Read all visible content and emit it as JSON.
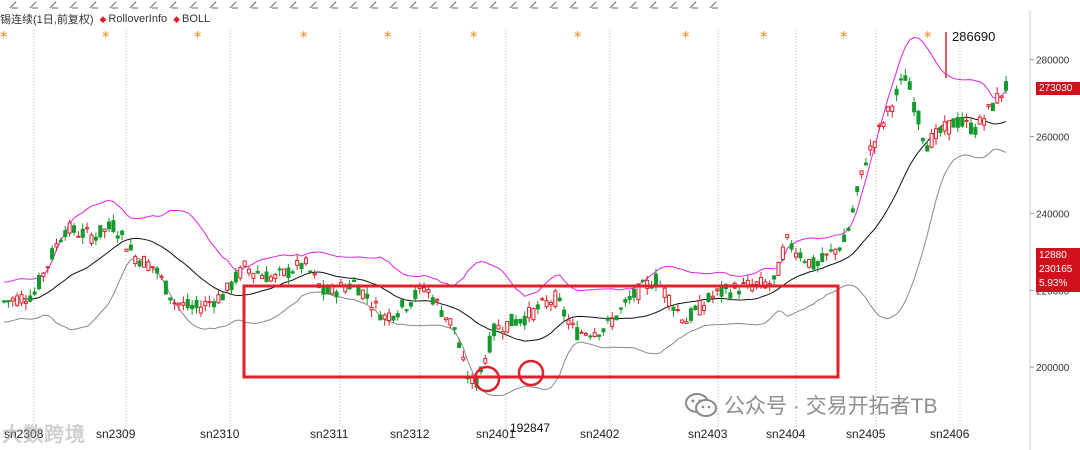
{
  "legend": {
    "title": "锡连续(1日,前复权)",
    "items": [
      {
        "label": "RolloverInfo",
        "color": "#e0202a"
      },
      {
        "label": "BOLL",
        "color": "#e0202a"
      }
    ]
  },
  "watermarks": {
    "left": "大数跨境",
    "right": "公众号 · 交易开拓者TB"
  },
  "price_badges": {
    "last_price": "273030",
    "info_line1": "12880",
    "info_line2": "230165",
    "info_line3": "5.93%"
  },
  "colors": {
    "up": "#e0202a",
    "down": "#139a2c",
    "boll_upper": "#e024e0",
    "boll_mid": "#111111",
    "boll_lower": "#888888",
    "box": "#e0202a",
    "marker": "#f08a1e"
  },
  "chart_data": {
    "type": "candlestick",
    "title": "",
    "xlabel": "",
    "ylabel": "",
    "ylim": [
      192000,
      290000
    ],
    "yticks": [
      200000,
      220000,
      240000,
      260000,
      280000
    ],
    "ytick_labels": [
      "200000",
      "220000",
      "240000",
      "260000",
      "280000"
    ],
    "x_tick_labels": [
      "sn2308",
      "sn2309",
      "sn2310",
      "sn2311",
      "sn2312",
      "sn2401",
      "sn2402",
      "sn2403",
      "sn2404",
      "sn2405",
      "sn2406"
    ],
    "annotations": [
      {
        "text": "286690",
        "type": "high",
        "value": 286690
      },
      {
        "text": "192847",
        "type": "low",
        "value": 192847
      }
    ],
    "rollover_markers": 11,
    "price_path": [
      {
        "t": 0,
        "v": 217000
      },
      {
        "t": 0.03,
        "v": 219000
      },
      {
        "t": 0.06,
        "v": 236000
      },
      {
        "t": 0.09,
        "v": 234000
      },
      {
        "t": 0.11,
        "v": 237000
      },
      {
        "t": 0.13,
        "v": 229000
      },
      {
        "t": 0.15,
        "v": 226000
      },
      {
        "t": 0.17,
        "v": 217000
      },
      {
        "t": 0.19,
        "v": 215000
      },
      {
        "t": 0.22,
        "v": 219000
      },
      {
        "t": 0.24,
        "v": 226000
      },
      {
        "t": 0.27,
        "v": 223000
      },
      {
        "t": 0.3,
        "v": 227000
      },
      {
        "t": 0.32,
        "v": 219000
      },
      {
        "t": 0.35,
        "v": 222000
      },
      {
        "t": 0.38,
        "v": 213000
      },
      {
        "t": 0.4,
        "v": 216000
      },
      {
        "t": 0.42,
        "v": 221000
      },
      {
        "t": 0.45,
        "v": 210000
      },
      {
        "t": 0.46,
        "v": 199000
      },
      {
        "t": 0.47,
        "v": 195000
      },
      {
        "t": 0.49,
        "v": 210000
      },
      {
        "t": 0.52,
        "v": 213000
      },
      {
        "t": 0.55,
        "v": 218000
      },
      {
        "t": 0.57,
        "v": 209000
      },
      {
        "t": 0.6,
        "v": 210000
      },
      {
        "t": 0.63,
        "v": 219000
      },
      {
        "t": 0.65,
        "v": 223000
      },
      {
        "t": 0.68,
        "v": 212000
      },
      {
        "t": 0.71,
        "v": 219000
      },
      {
        "t": 0.74,
        "v": 221000
      },
      {
        "t": 0.77,
        "v": 222000
      },
      {
        "t": 0.78,
        "v": 233000
      },
      {
        "t": 0.81,
        "v": 226000
      },
      {
        "t": 0.84,
        "v": 233000
      },
      {
        "t": 0.86,
        "v": 254000
      },
      {
        "t": 0.88,
        "v": 265000
      },
      {
        "t": 0.9,
        "v": 276000
      },
      {
        "t": 0.92,
        "v": 258000
      },
      {
        "t": 0.95,
        "v": 264000
      },
      {
        "t": 0.97,
        "v": 262000
      },
      {
        "t": 1.0,
        "v": 273030
      }
    ]
  }
}
